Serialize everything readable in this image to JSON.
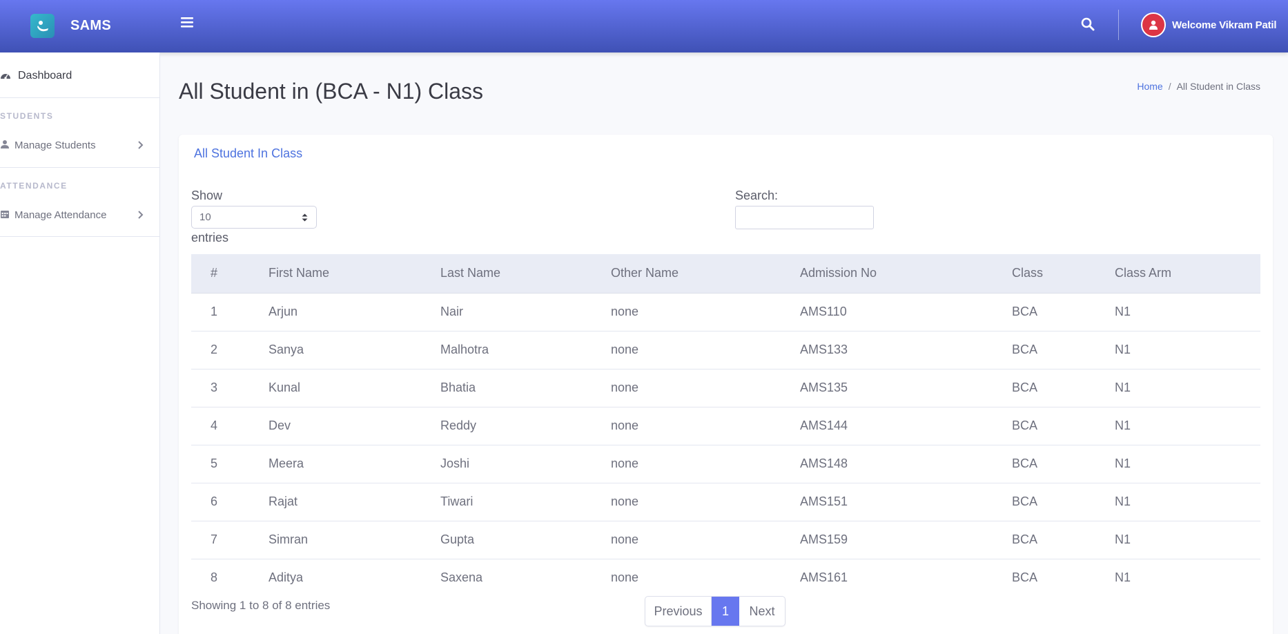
{
  "app": {
    "brand": "SAMS",
    "user_greeting": "Welcome Vikram Patil",
    "accent_color": "#6777ef"
  },
  "sidebar": {
    "dashboard": "Dashboard",
    "sections": [
      {
        "heading": "STUDENTS",
        "item": "Manage Students"
      },
      {
        "heading": "ATTENDANCE",
        "item": "Manage Attendance"
      }
    ]
  },
  "page": {
    "title": "All Student in (BCA - N1) Class",
    "breadcrumb": {
      "home": "Home",
      "separator": "/",
      "current": "All Student in Class"
    }
  },
  "card": {
    "title": "All Student In Class",
    "length_label": "Show",
    "length_value": "10",
    "entries_label": "entries",
    "search_label": "Search:",
    "search_value": ""
  },
  "table": {
    "columns": [
      "#",
      "First Name",
      "Last Name",
      "Other Name",
      "Admission No",
      "Class",
      "Class Arm"
    ],
    "rows": [
      [
        "1",
        "Arjun",
        "Nair",
        "none",
        "AMS110",
        "BCA",
        "N1"
      ],
      [
        "2",
        "Sanya",
        "Malhotra",
        "none",
        "AMS133",
        "BCA",
        "N1"
      ],
      [
        "3",
        "Kunal",
        "Bhatia",
        "none",
        "AMS135",
        "BCA",
        "N1"
      ],
      [
        "4",
        "Dev",
        "Reddy",
        "none",
        "AMS144",
        "BCA",
        "N1"
      ],
      [
        "5",
        "Meera",
        "Joshi",
        "none",
        "AMS148",
        "BCA",
        "N1"
      ],
      [
        "6",
        "Rajat",
        "Tiwari",
        "none",
        "AMS151",
        "BCA",
        "N1"
      ],
      [
        "7",
        "Simran",
        "Gupta",
        "none",
        "AMS159",
        "BCA",
        "N1"
      ],
      [
        "8",
        "Aditya",
        "Saxena",
        "none",
        "AMS161",
        "BCA",
        "N1"
      ]
    ]
  },
  "footer": {
    "info": "Showing 1 to 8 of 8 entries",
    "previous": "Previous",
    "current_page": "1",
    "next": "Next"
  }
}
